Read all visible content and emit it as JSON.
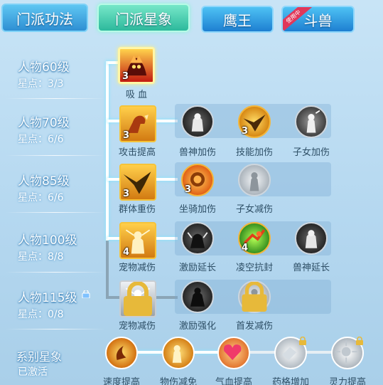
{
  "tabs": [
    {
      "label": "门派功法"
    },
    {
      "label": "门派星象"
    },
    {
      "label": "鹰王"
    },
    {
      "label": "斗兽",
      "badge": "使用中"
    }
  ],
  "levels": [
    {
      "name": "人物60级",
      "stars": "星点：3/3"
    },
    {
      "name": "人物70级",
      "stars": "星点：6/6"
    },
    {
      "name": "人物85级",
      "stars": "星点：6/6"
    },
    {
      "name": "人物100级",
      "stars": "星点：8/8"
    },
    {
      "name": "人物115级",
      "stars": "星点：0/8",
      "locked": true
    }
  ],
  "rows": [
    {
      "main": {
        "label": "吸 血",
        "count": "3",
        "icon": "vampire-beast-icon"
      },
      "subs": []
    },
    {
      "main": {
        "label": "攻击提高",
        "count": "3",
        "icon": "flexed-arm-icon"
      },
      "subs": [
        {
          "label": "兽神加伤",
          "count": "",
          "icon": "beast-god-icon"
        },
        {
          "label": "技能加伤",
          "count": "3",
          "icon": "eagle-icon"
        },
        {
          "label": "子女加伤",
          "count": "",
          "icon": "child-sword-icon"
        }
      ]
    },
    {
      "main": {
        "label": "群体重伤",
        "count": "3",
        "icon": "eagle-swoop-icon"
      },
      "subs": [
        {
          "label": "坐骑加伤",
          "count": "3",
          "icon": "lion-mount-icon"
        },
        {
          "label": "子女减伤",
          "count": "",
          "icon": "child-shield-icon"
        }
      ]
    },
    {
      "main": {
        "label": "宠物减伤",
        "count": "4",
        "icon": "pet-shield-icon"
      },
      "subs": [
        {
          "label": "激励延长",
          "count": "",
          "icon": "inspire-figure-icon"
        },
        {
          "label": "凌空抗封",
          "count": "4",
          "icon": "leap-resist-icon"
        },
        {
          "label": "兽神延长",
          "count": "",
          "icon": "beast-god-extend-icon"
        }
      ]
    },
    {
      "main": {
        "label": "宠物减伤",
        "count": "",
        "icon": "pet-shield-icon",
        "locked": true
      },
      "subs": [
        {
          "label": "激励强化",
          "count": "",
          "icon": "inspire-strong-icon",
          "locked": false
        },
        {
          "label": "首发减伤",
          "count": "",
          "icon": "first-strike-icon",
          "locked": true
        }
      ]
    }
  ],
  "series": {
    "title": "系别星象",
    "status": "已激活",
    "items": [
      {
        "label": "速度提高",
        "icon": "speed-icon",
        "locked": false
      },
      {
        "label": "物伤减免",
        "icon": "phys-reduce-icon",
        "locked": false
      },
      {
        "label": "气血提高",
        "icon": "heart-icon",
        "locked": false
      },
      {
        "label": "药格增加",
        "icon": "potion-slot-icon",
        "locked": true
      },
      {
        "label": "灵力提高",
        "icon": "spirit-burst-icon",
        "locked": true
      }
    ]
  },
  "colors": {
    "accent": "#2db99c",
    "tab_blue": "#2e8fd3",
    "badge": "#e0385a",
    "gold": "#f5c33a"
  }
}
